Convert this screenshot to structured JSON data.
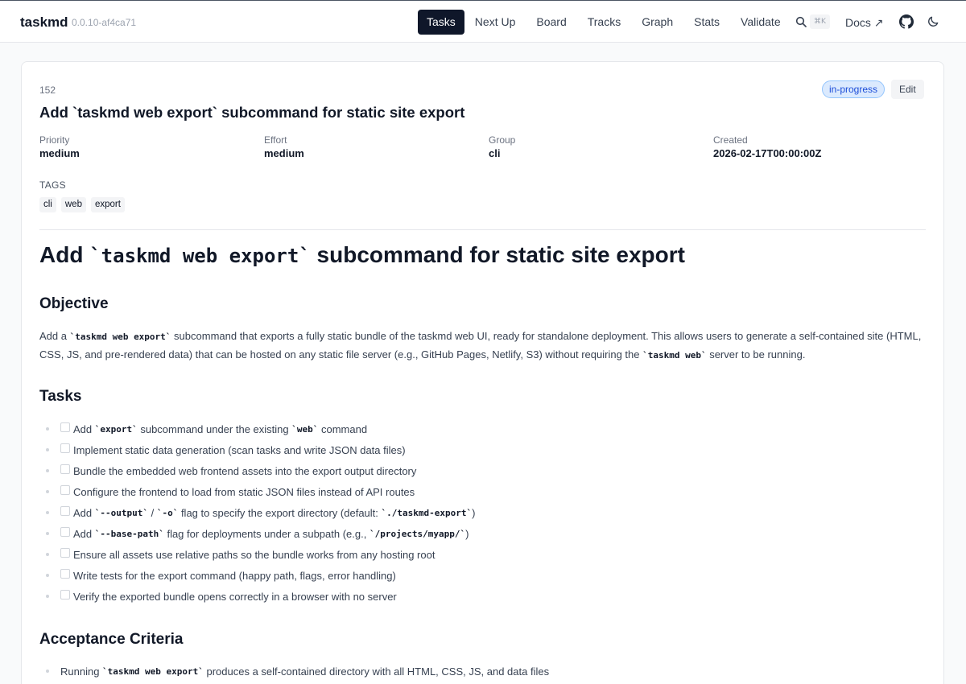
{
  "header": {
    "brand": "taskmd",
    "version": "0.0.10-af4ca71",
    "nav": [
      {
        "label": "Tasks",
        "active": true
      },
      {
        "label": "Next Up",
        "active": false
      },
      {
        "label": "Board",
        "active": false
      },
      {
        "label": "Tracks",
        "active": false
      },
      {
        "label": "Graph",
        "active": false
      },
      {
        "label": "Stats",
        "active": false
      },
      {
        "label": "Validate",
        "active": false
      }
    ],
    "search_shortcut": "⌘K",
    "docs_label": "Docs ↗",
    "icons": [
      "search-icon",
      "external-link-icon",
      "github-icon",
      "moon-icon"
    ]
  },
  "task": {
    "id": "152",
    "title": "Add `taskmd web export` subcommand for static site export",
    "status": "in-progress",
    "edit_label": "Edit",
    "meta": [
      {
        "label": "Priority",
        "value": "medium"
      },
      {
        "label": "Effort",
        "value": "medium"
      },
      {
        "label": "Group",
        "value": "cli"
      },
      {
        "label": "Created",
        "value": "2026-02-17T00:00:00Z"
      }
    ],
    "tags_label": "TAGS",
    "tags": [
      "cli",
      "web",
      "export"
    ]
  },
  "content": {
    "h1_prefix": "Add ",
    "h1_code": "`taskmd web export`",
    "h1_suffix": " subcommand for static site export",
    "objective_heading": "Objective",
    "objective": {
      "p1": "Add a ",
      "c1": "`taskmd web export`",
      "p2": " subcommand that exports a fully static bundle of the taskmd web UI, ready for standalone deployment. This allows users to generate a self-contained site (HTML, CSS, JS, and pre-rendered data) that can be hosted on any static file server (e.g., GitHub Pages, Netlify, S3) without requiring the ",
      "c2": "`taskmd web`",
      "p3": " server to be running."
    },
    "tasks_heading": "Tasks",
    "tasks": [
      [
        {
          "t": "Add "
        },
        {
          "c": "`export`"
        },
        {
          "t": " subcommand under the existing "
        },
        {
          "c": "`web`"
        },
        {
          "t": " command"
        }
      ],
      [
        {
          "t": "Implement static data generation (scan tasks and write JSON data files)"
        }
      ],
      [
        {
          "t": "Bundle the embedded web frontend assets into the export output directory"
        }
      ],
      [
        {
          "t": "Configure the frontend to load from static JSON files instead of API routes"
        }
      ],
      [
        {
          "t": "Add "
        },
        {
          "c": "`--output`"
        },
        {
          "t": " / "
        },
        {
          "c": "`-o`"
        },
        {
          "t": " flag to specify the export directory (default: "
        },
        {
          "c": "`./taskmd-export`"
        },
        {
          "t": ")"
        }
      ],
      [
        {
          "t": "Add "
        },
        {
          "c": "`--base-path`"
        },
        {
          "t": " flag for deployments under a subpath (e.g., "
        },
        {
          "c": "`/projects/myapp/`"
        },
        {
          "t": ")"
        }
      ],
      [
        {
          "t": "Ensure all assets use relative paths so the bundle works from any hosting root"
        }
      ],
      [
        {
          "t": "Write tests for the export command (happy path, flags, error handling)"
        }
      ],
      [
        {
          "t": "Verify the exported bundle opens correctly in a browser with no server"
        }
      ]
    ],
    "acceptance_heading": "Acceptance Criteria",
    "acceptance": [
      [
        {
          "t": "Running "
        },
        {
          "c": "`taskmd web export`"
        },
        {
          "t": " produces a self-contained directory with all HTML, CSS, JS, and data files"
        }
      ]
    ]
  }
}
